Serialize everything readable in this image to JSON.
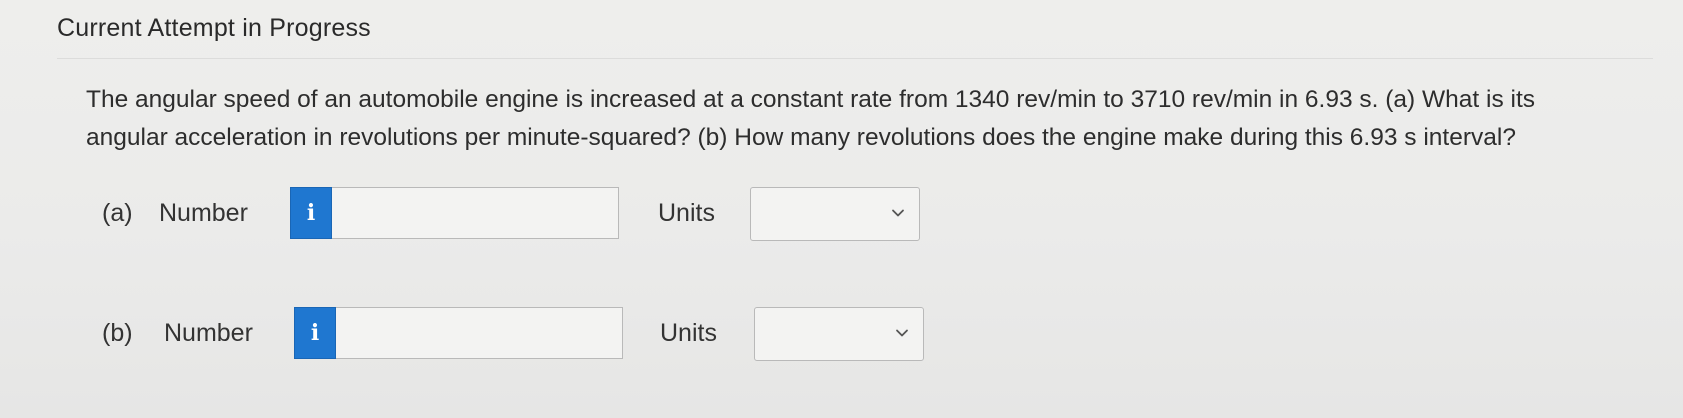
{
  "header": {
    "title": "Current Attempt in Progress"
  },
  "question": {
    "text": "The angular speed of an automobile engine is increased at a constant rate from 1340 rev/min to 3710 rev/min in 6.93 s. (a) What is its angular acceleration in revolutions per minute-squared? (b) How many revolutions does the engine make during this 6.93 s interval?"
  },
  "parts": [
    {
      "part_label": "(a)",
      "number_label": "Number",
      "info_glyph": "i",
      "number_value": "",
      "units_label": "Units",
      "units_selected": ""
    },
    {
      "part_label": "(b)",
      "number_label": "Number",
      "info_glyph": "i",
      "number_value": "",
      "units_label": "Units",
      "units_selected": ""
    }
  ],
  "icons": {
    "info": "info-icon",
    "dropdown": "chevron-down-icon"
  },
  "colors": {
    "info_button": "#1f77d0",
    "background": "#ececeb",
    "input_border": "#b9b9b9"
  }
}
